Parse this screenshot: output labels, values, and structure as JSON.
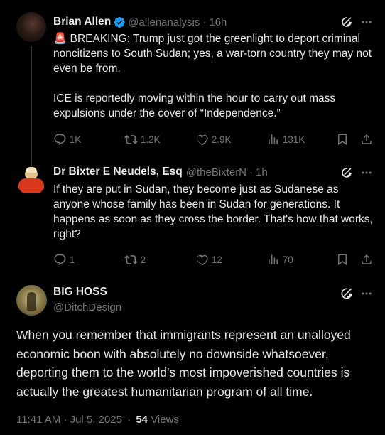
{
  "tweet1": {
    "display_name": "Brian Allen",
    "handle": "@allenanalysis",
    "time": "16h",
    "text_line1": "🚨 BREAKING: Trump just got the greenlight to deport criminal noncitizens to South Sudan; yes, a war-torn country they may not even be from.",
    "text_line2": "ICE is reportedly moving within the hour to carry out mass expulsions under the cover of “Independence.”",
    "replies": "1K",
    "reposts": "1.2K",
    "likes": "2.9K",
    "views": "131K"
  },
  "tweet2": {
    "display_name": "Dr Bixter E Neudels, Esq",
    "handle": "@theBixterN",
    "time": "1h",
    "text": "If they are put in Sudan, they become just as Sudanese as anyone whose family has been in Sudan for generations. It happens as soon as they cross the border. That's how that works, right?",
    "replies": "1",
    "reposts": "2",
    "likes": "12",
    "views": "70"
  },
  "main_tweet": {
    "display_name": "BIG HOSS",
    "handle": "@DitchDesign",
    "text": "When you remember that immigrants represent an unalloyed economic boon with absolutely no downside whatsoever, deporting them to the world's most impoverished countries is actually the greatest humanitarian program of all time.",
    "timestamp": "11:41 AM · Jul 5, 2025",
    "separator": "·",
    "view_count": "54",
    "views_label": "Views"
  },
  "colors": {
    "background": "#000000",
    "text": "#e7e9ea",
    "muted": "#71767b",
    "verified": "#1d9bf0",
    "thread_line": "#333639"
  },
  "icons": [
    "verified-badge-icon",
    "grok-icon",
    "more-icon",
    "reply-icon",
    "repost-icon",
    "like-icon",
    "views-icon",
    "bookmark-icon",
    "share-icon"
  ]
}
